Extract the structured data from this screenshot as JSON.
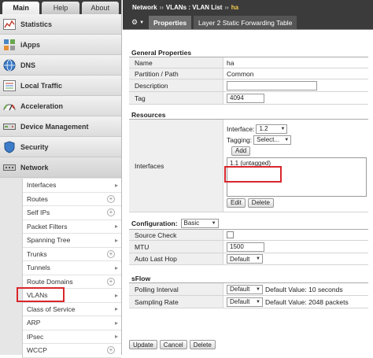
{
  "sidebar": {
    "tabs": [
      "Main",
      "Help",
      "About"
    ],
    "items": [
      {
        "label": "Statistics",
        "icon": "statistics-icon"
      },
      {
        "label": "iApps",
        "icon": "iapps-icon"
      },
      {
        "label": "DNS",
        "icon": "dns-icon"
      },
      {
        "label": "Local Traffic",
        "icon": "local-traffic-icon"
      },
      {
        "label": "Acceleration",
        "icon": "acceleration-icon"
      },
      {
        "label": "Device Management",
        "icon": "device-management-icon"
      },
      {
        "label": "Security",
        "icon": "security-icon"
      },
      {
        "label": "Network",
        "icon": "network-icon"
      }
    ],
    "network_sub": [
      {
        "label": "Interfaces",
        "plus": false,
        "arrow": true
      },
      {
        "label": "Routes",
        "plus": true,
        "arrow": false
      },
      {
        "label": "Self IPs",
        "plus": true,
        "arrow": false
      },
      {
        "label": "Packet Filters",
        "plus": false,
        "arrow": true
      },
      {
        "label": "Spanning Tree",
        "plus": false,
        "arrow": true
      },
      {
        "label": "Trunks",
        "plus": true,
        "arrow": false
      },
      {
        "label": "Tunnels",
        "plus": false,
        "arrow": true
      },
      {
        "label": "Route Domains",
        "plus": true,
        "arrow": false
      },
      {
        "label": "VLANs",
        "plus": false,
        "arrow": true
      },
      {
        "label": "Class of Service",
        "plus": false,
        "arrow": true
      },
      {
        "label": "ARP",
        "plus": false,
        "arrow": true
      },
      {
        "label": "IPsec",
        "plus": false,
        "arrow": true
      },
      {
        "label": "WCCP",
        "plus": true,
        "arrow": false
      }
    ]
  },
  "header": {
    "crumb1": "Network",
    "sep1": "››",
    "crumb2": "VLANs : VLAN List",
    "sep2": "››",
    "current": "ha",
    "tabs": [
      "Properties",
      "Layer 2 Static Forwarding Table"
    ]
  },
  "general": {
    "title": "General Properties",
    "name_label": "Name",
    "name_value": "ha",
    "partition_label": "Partition / Path",
    "partition_value": "Common",
    "description_label": "Description",
    "description_value": "",
    "tag_label": "Tag",
    "tag_value": "4094"
  },
  "resources": {
    "title": "Resources",
    "interfaces_label": "Interfaces",
    "interface_field_label": "Interface:",
    "interface_value": "1.2",
    "tagging_label": "Tagging:",
    "tagging_value": "Select...",
    "add_label": "Add",
    "list_items": [
      "1.1 (untagged)"
    ],
    "edit_label": "Edit",
    "delete_label": "Delete"
  },
  "configuration": {
    "title": "Configuration:",
    "mode": "Basic",
    "source_check_label": "Source Check",
    "source_check": false,
    "mtu_label": "MTU",
    "mtu_value": "1500",
    "auto_last_hop_label": "Auto Last Hop",
    "auto_last_hop_value": "Default"
  },
  "sflow": {
    "title": "sFlow",
    "polling_label": "Polling Interval",
    "polling_value": "Default",
    "polling_note": "Default Value: 10 seconds",
    "sampling_label": "Sampling Rate",
    "sampling_value": "Default",
    "sampling_note": "Default Value: 2048 packets"
  },
  "actions": {
    "update": "Update",
    "cancel": "Cancel",
    "delete": "Delete"
  },
  "colors": {
    "highlight": "#d9262b",
    "header_bg": "#3b3b3b",
    "current_crumb": "#f2c94c"
  }
}
